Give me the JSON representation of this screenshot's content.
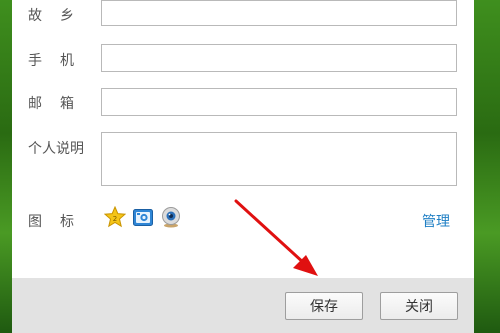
{
  "form": {
    "hometown": {
      "label": "故乡",
      "value": ""
    },
    "phone": {
      "label": "手机",
      "value": ""
    },
    "email": {
      "label": "邮箱",
      "value": ""
    },
    "bio": {
      "label": "个人说明",
      "value": ""
    },
    "icons": {
      "label": "图标",
      "items": [
        "star-badge-icon",
        "camera-badge-icon",
        "webcam-badge-icon"
      ]
    },
    "manage_label": "管理"
  },
  "footer": {
    "save_label": "保存",
    "close_label": "关闭"
  },
  "colors": {
    "accent_link": "#1f7fc4",
    "annotation_arrow": "#e01010",
    "footer_bg": "#e2e2e2",
    "desktop_green": "#3a8a1c"
  }
}
